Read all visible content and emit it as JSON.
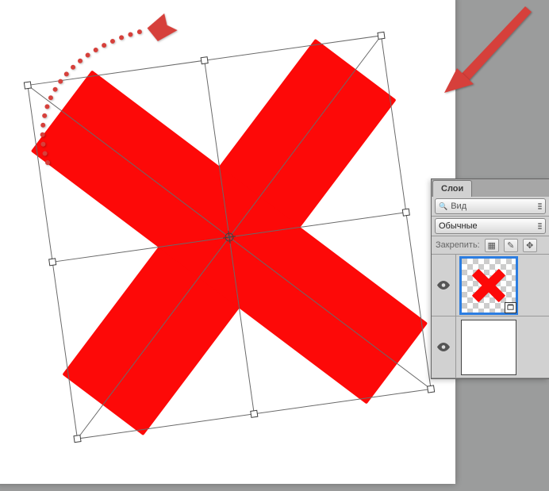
{
  "panel": {
    "tab_label": "Слои",
    "filter_placeholder": "Вид",
    "blend_mode": "Обычные",
    "lock_label": "Закрепить:"
  },
  "icons": {
    "search": "🔍",
    "transparency": "▦",
    "brush": "✎",
    "move": "✥"
  },
  "colors": {
    "accent": "#fd0908",
    "annotation": "#d6403b"
  },
  "transform": {
    "rotation_deg": -8
  },
  "layers": [
    {
      "visible": true,
      "type": "smart-object",
      "content": "red-x",
      "selected": true
    },
    {
      "visible": true,
      "type": "background",
      "content": "white",
      "selected": false
    }
  ]
}
